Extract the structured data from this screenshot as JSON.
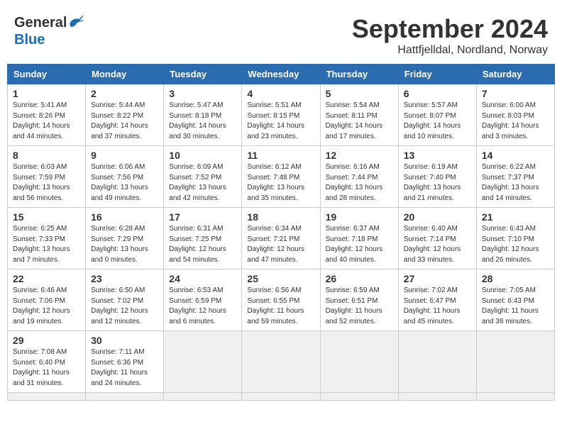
{
  "header": {
    "logo_general": "General",
    "logo_blue": "Blue",
    "month_title": "September 2024",
    "location": "Hattfjelldal, Nordland, Norway"
  },
  "weekdays": [
    "Sunday",
    "Monday",
    "Tuesday",
    "Wednesday",
    "Thursday",
    "Friday",
    "Saturday"
  ],
  "days": [
    {
      "num": "",
      "info": ""
    },
    {
      "num": "",
      "info": ""
    },
    {
      "num": "",
      "info": ""
    },
    {
      "num": "",
      "info": ""
    },
    {
      "num": "",
      "info": ""
    },
    {
      "num": "",
      "info": ""
    },
    {
      "num": "1",
      "info": "Sunrise: 5:41 AM\nSunset: 8:26 PM\nDaylight: 14 hours\nand 44 minutes."
    },
    {
      "num": "2",
      "info": "Sunrise: 5:44 AM\nSunset: 8:22 PM\nDaylight: 14 hours\nand 37 minutes."
    },
    {
      "num": "3",
      "info": "Sunrise: 5:47 AM\nSunset: 8:18 PM\nDaylight: 14 hours\nand 30 minutes."
    },
    {
      "num": "4",
      "info": "Sunrise: 5:51 AM\nSunset: 8:15 PM\nDaylight: 14 hours\nand 23 minutes."
    },
    {
      "num": "5",
      "info": "Sunrise: 5:54 AM\nSunset: 8:11 PM\nDaylight: 14 hours\nand 17 minutes."
    },
    {
      "num": "6",
      "info": "Sunrise: 5:57 AM\nSunset: 8:07 PM\nDaylight: 14 hours\nand 10 minutes."
    },
    {
      "num": "7",
      "info": "Sunrise: 6:00 AM\nSunset: 8:03 PM\nDaylight: 14 hours\nand 3 minutes."
    },
    {
      "num": "8",
      "info": "Sunrise: 6:03 AM\nSunset: 7:59 PM\nDaylight: 13 hours\nand 56 minutes."
    },
    {
      "num": "9",
      "info": "Sunrise: 6:06 AM\nSunset: 7:56 PM\nDaylight: 13 hours\nand 49 minutes."
    },
    {
      "num": "10",
      "info": "Sunrise: 6:09 AM\nSunset: 7:52 PM\nDaylight: 13 hours\nand 42 minutes."
    },
    {
      "num": "11",
      "info": "Sunrise: 6:12 AM\nSunset: 7:48 PM\nDaylight: 13 hours\nand 35 minutes."
    },
    {
      "num": "12",
      "info": "Sunrise: 6:16 AM\nSunset: 7:44 PM\nDaylight: 13 hours\nand 28 minutes."
    },
    {
      "num": "13",
      "info": "Sunrise: 6:19 AM\nSunset: 7:40 PM\nDaylight: 13 hours\nand 21 minutes."
    },
    {
      "num": "14",
      "info": "Sunrise: 6:22 AM\nSunset: 7:37 PM\nDaylight: 13 hours\nand 14 minutes."
    },
    {
      "num": "15",
      "info": "Sunrise: 6:25 AM\nSunset: 7:33 PM\nDaylight: 13 hours\nand 7 minutes."
    },
    {
      "num": "16",
      "info": "Sunrise: 6:28 AM\nSunset: 7:29 PM\nDaylight: 13 hours\nand 0 minutes."
    },
    {
      "num": "17",
      "info": "Sunrise: 6:31 AM\nSunset: 7:25 PM\nDaylight: 12 hours\nand 54 minutes."
    },
    {
      "num": "18",
      "info": "Sunrise: 6:34 AM\nSunset: 7:21 PM\nDaylight: 12 hours\nand 47 minutes."
    },
    {
      "num": "19",
      "info": "Sunrise: 6:37 AM\nSunset: 7:18 PM\nDaylight: 12 hours\nand 40 minutes."
    },
    {
      "num": "20",
      "info": "Sunrise: 6:40 AM\nSunset: 7:14 PM\nDaylight: 12 hours\nand 33 minutes."
    },
    {
      "num": "21",
      "info": "Sunrise: 6:43 AM\nSunset: 7:10 PM\nDaylight: 12 hours\nand 26 minutes."
    },
    {
      "num": "22",
      "info": "Sunrise: 6:46 AM\nSunset: 7:06 PM\nDaylight: 12 hours\nand 19 minutes."
    },
    {
      "num": "23",
      "info": "Sunrise: 6:50 AM\nSunset: 7:02 PM\nDaylight: 12 hours\nand 12 minutes."
    },
    {
      "num": "24",
      "info": "Sunrise: 6:53 AM\nSunset: 6:59 PM\nDaylight: 12 hours\nand 6 minutes."
    },
    {
      "num": "25",
      "info": "Sunrise: 6:56 AM\nSunset: 6:55 PM\nDaylight: 11 hours\nand 59 minutes."
    },
    {
      "num": "26",
      "info": "Sunrise: 6:59 AM\nSunset: 6:51 PM\nDaylight: 11 hours\nand 52 minutes."
    },
    {
      "num": "27",
      "info": "Sunrise: 7:02 AM\nSunset: 6:47 PM\nDaylight: 11 hours\nand 45 minutes."
    },
    {
      "num": "28",
      "info": "Sunrise: 7:05 AM\nSunset: 6:43 PM\nDaylight: 11 hours\nand 38 minutes."
    },
    {
      "num": "29",
      "info": "Sunrise: 7:08 AM\nSunset: 6:40 PM\nDaylight: 11 hours\nand 31 minutes."
    },
    {
      "num": "30",
      "info": "Sunrise: 7:11 AM\nSunset: 6:36 PM\nDaylight: 11 hours\nand 24 minutes."
    },
    {
      "num": "",
      "info": ""
    },
    {
      "num": "",
      "info": ""
    },
    {
      "num": "",
      "info": ""
    },
    {
      "num": "",
      "info": ""
    },
    {
      "num": "",
      "info": ""
    }
  ]
}
